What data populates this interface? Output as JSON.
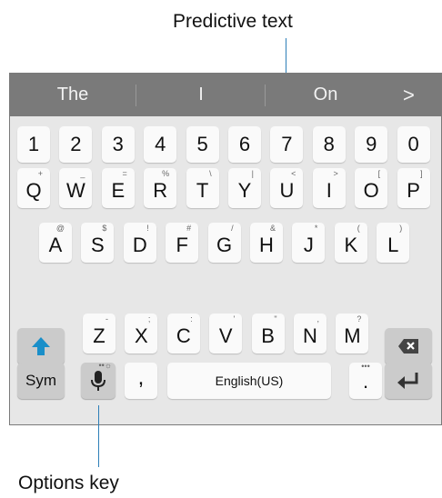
{
  "callouts": {
    "top": "Predictive text",
    "bottom": "Options key"
  },
  "prediction_bar": {
    "words": [
      "The",
      "I",
      "On"
    ],
    "more_glyph": ">"
  },
  "keyboard": {
    "numbers": [
      "1",
      "2",
      "3",
      "4",
      "5",
      "6",
      "7",
      "8",
      "9",
      "0"
    ],
    "row1": [
      {
        "key": "Q",
        "alt": "+"
      },
      {
        "key": "W",
        "alt": "_"
      },
      {
        "key": "E",
        "alt": "="
      },
      {
        "key": "R",
        "alt": "%"
      },
      {
        "key": "T",
        "alt": "\\"
      },
      {
        "key": "Y",
        "alt": "|"
      },
      {
        "key": "U",
        "alt": "<"
      },
      {
        "key": "I",
        "alt": ">"
      },
      {
        "key": "O",
        "alt": "["
      },
      {
        "key": "P",
        "alt": "]"
      }
    ],
    "row2": [
      {
        "key": "A",
        "alt": "@"
      },
      {
        "key": "S",
        "alt": "$"
      },
      {
        "key": "D",
        "alt": "!"
      },
      {
        "key": "F",
        "alt": "#"
      },
      {
        "key": "G",
        "alt": "/"
      },
      {
        "key": "H",
        "alt": "&"
      },
      {
        "key": "J",
        "alt": "*"
      },
      {
        "key": "K",
        "alt": "("
      },
      {
        "key": "L",
        "alt": ")"
      }
    ],
    "row3": [
      {
        "key": "Z",
        "alt": "-"
      },
      {
        "key": "X",
        "alt": ";"
      },
      {
        "key": "C",
        "alt": ":"
      },
      {
        "key": "V",
        "alt": "'"
      },
      {
        "key": "B",
        "alt": "\""
      },
      {
        "key": "N",
        "alt": ","
      },
      {
        "key": "M",
        "alt": "?"
      }
    ],
    "bottom_row": {
      "sym": "Sym",
      "options_dots": "••☼",
      "comma": ",",
      "space": "English(US)",
      "period": ".",
      "period_dots": "•••"
    }
  },
  "colors": {
    "accent": "#1a8fc9",
    "leader": "#2d7fb8",
    "prediction_bar": "#7a7a7a",
    "keyboard_bg": "#e7e7e7"
  }
}
